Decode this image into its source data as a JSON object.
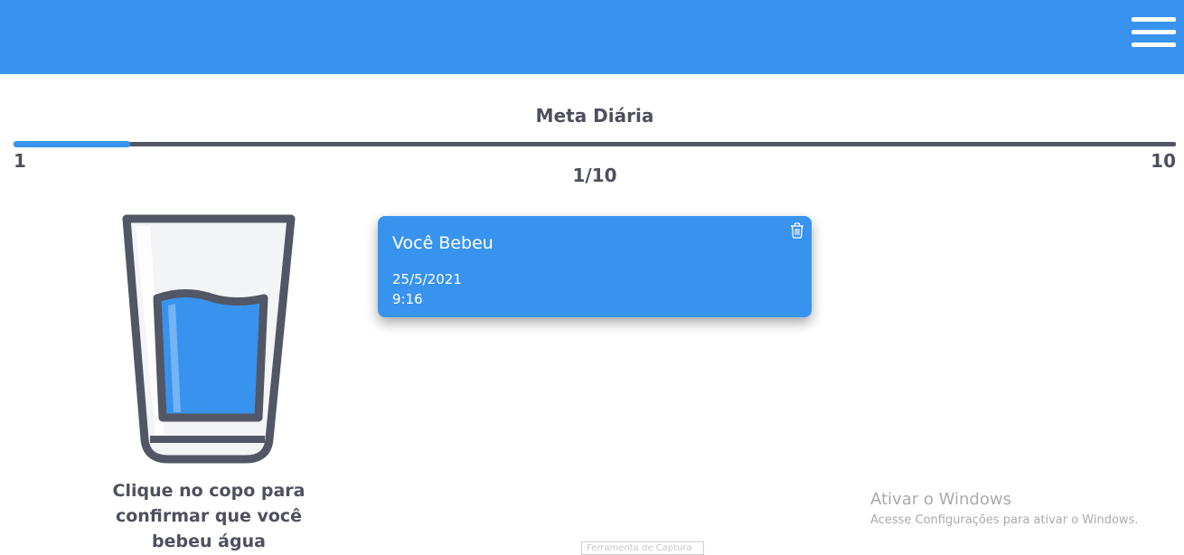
{
  "header": {
    "menu_icon": "hamburger-menu-icon",
    "background_color": "#3893ee"
  },
  "goal": {
    "title": "Meta Diária",
    "min_label": "1",
    "max_label": "10",
    "count_label": "1/10",
    "progress_fraction": 0.1,
    "accent_color": "#3893ee"
  },
  "glass": {
    "icon": "water-glass-icon",
    "caption": "Clique no copo para confirmar que você bebeu água"
  },
  "entries": [
    {
      "title": "Você Bebeu",
      "date": "25/5/2021",
      "time": "9:16",
      "delete_icon": "trash-icon"
    }
  ],
  "windows_watermark": {
    "title": "Ativar o Windows",
    "subtitle": "Acesse Configurações para ativar o Windows."
  },
  "tooltip": {
    "text": "Ferramenta de Captura"
  }
}
